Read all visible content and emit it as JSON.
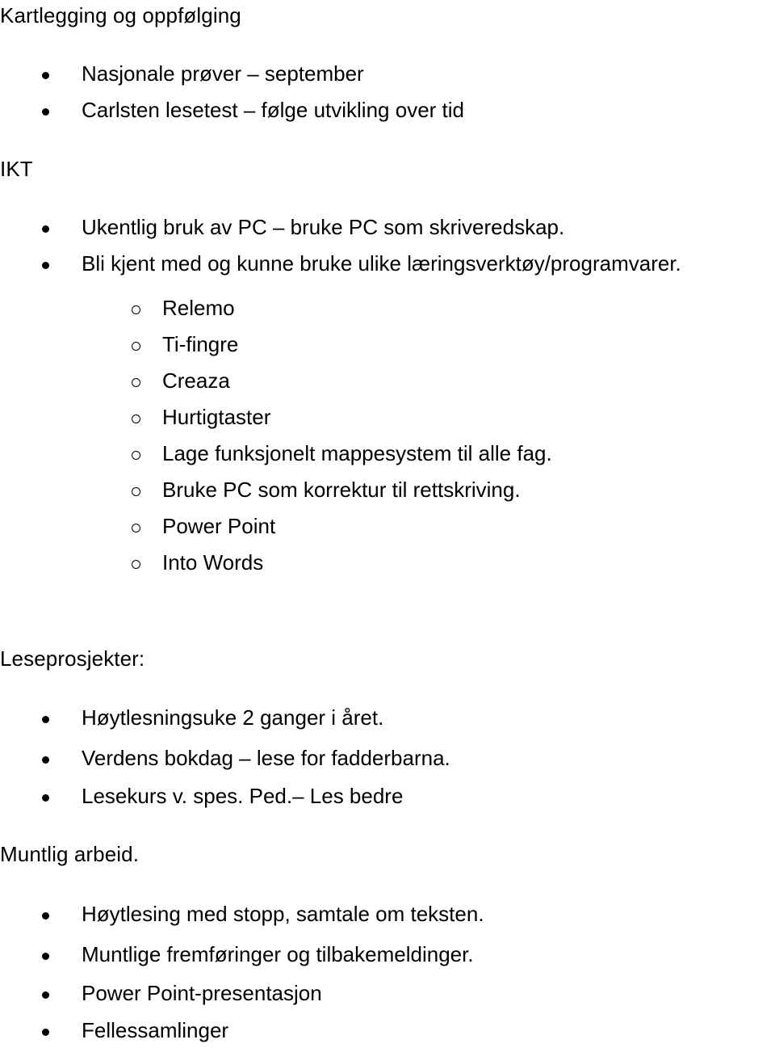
{
  "document": {
    "language": "Norwegian",
    "background_color": "#ffffff",
    "text_color": "#000000",
    "title": "Kartlegging og oppfølging"
  },
  "sections": [
    {
      "heading": "Kartlegging og oppfølging",
      "bullets": [
        "Nasjonale prøver – september",
        "Carlsten lesetest – følge utvikling over tid"
      ]
    },
    {
      "heading": "IKT",
      "bullets": [
        "Ukentlig bruk av PC – bruke PC som skriveredskap.",
        "Bli kjent med og kunne bruke ulike læringsverktøy/programvarer."
      ],
      "subbullets": [
        "Relemo",
        "Ti-fingre",
        "Creaza",
        "Hurtigtaster",
        "Lage funksjonelt mappesystem til alle fag.",
        "Bruke PC som korrektur til rettskriving.",
        "Power Point",
        "Into Words"
      ]
    },
    {
      "heading": "Leseprosjekter:",
      "bullets": [
        "Høytlesningsuke 2 ganger i året.",
        "Verdens bokdag – lese for fadderbarna.",
        "Lesekurs v. spes. Ped.– Les bedre"
      ]
    },
    {
      "heading": "Muntlig arbeid.",
      "bullets": [
        "Høytlesing med stopp, samtale om teksten.",
        "Muntlige fremføringer og tilbakemeldinger.",
        "Power Point-presentasjon",
        "Fellessamlinger"
      ]
    }
  ],
  "markers": {
    "level1": "•",
    "level2": "o"
  }
}
